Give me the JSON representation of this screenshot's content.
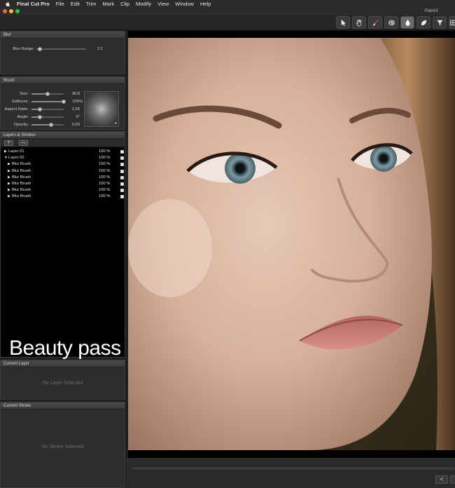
{
  "menubar": {
    "app_name": "Final Cut Pro",
    "items": [
      "File",
      "Edit",
      "Trim",
      "Mark",
      "Clip",
      "Modify",
      "View",
      "Window",
      "Help"
    ]
  },
  "window": {
    "title": "PaintX"
  },
  "toolbar": {
    "tools": [
      "arrow-icon",
      "hand-icon",
      "brush-icon",
      "palette-icon",
      "drop-icon",
      "smudge-icon",
      "filter-icon",
      "grid-icon"
    ],
    "active_tool": "drop-icon"
  },
  "blur_panel": {
    "title": "Blur",
    "blur_range": {
      "label": "Blur Range:",
      "value": "2.1",
      "level": 0.05
    }
  },
  "brush_panel": {
    "title": "Brush",
    "size": {
      "label": "Size:",
      "value": "36.8",
      "level": 0.5
    },
    "softness": {
      "label": "Softness:",
      "value": "100%",
      "level": 1.0
    },
    "aspect_ratio": {
      "label": "Aspect Ratio:",
      "value": "1.00",
      "level": 0.25
    },
    "angle": {
      "label": "Angle:",
      "value": "0°",
      "level": 0.25
    },
    "opacity": {
      "label": "Opacity:",
      "value": "0.60",
      "level": 0.6
    }
  },
  "layers_panel": {
    "title": "Layers & Strokes",
    "add_label": "+",
    "remove_label": "—",
    "rows": [
      {
        "name": "Layer 01",
        "opacity": "100 %",
        "level": 0
      },
      {
        "name": "Layer 02",
        "opacity": "100 %",
        "level": 0,
        "expanded": true
      },
      {
        "name": "Blur Brush",
        "opacity": "100 %",
        "level": 1
      },
      {
        "name": "Blur Brush",
        "opacity": "100 %",
        "level": 1
      },
      {
        "name": "Blur Brush",
        "opacity": "100 %",
        "level": 1
      },
      {
        "name": "Blur Brush",
        "opacity": "100 %",
        "level": 1
      },
      {
        "name": "Blur Brush",
        "opacity": "100 %",
        "level": 1
      },
      {
        "name": "Blur Brush",
        "opacity": "100 %",
        "level": 1
      }
    ]
  },
  "overlay_caption": "Beauty pass",
  "current_layer_panel": {
    "title": "Current Layer",
    "message": "No Layer Selected"
  },
  "current_stroke_panel": {
    "title": "Current Stroke",
    "message": "No Stroke Selected"
  },
  "bottom": {
    "prev_label": "<"
  },
  "colors": {
    "accent": "#6a6a6a",
    "panel": "#2d2d2d",
    "canvas": "#000000"
  }
}
